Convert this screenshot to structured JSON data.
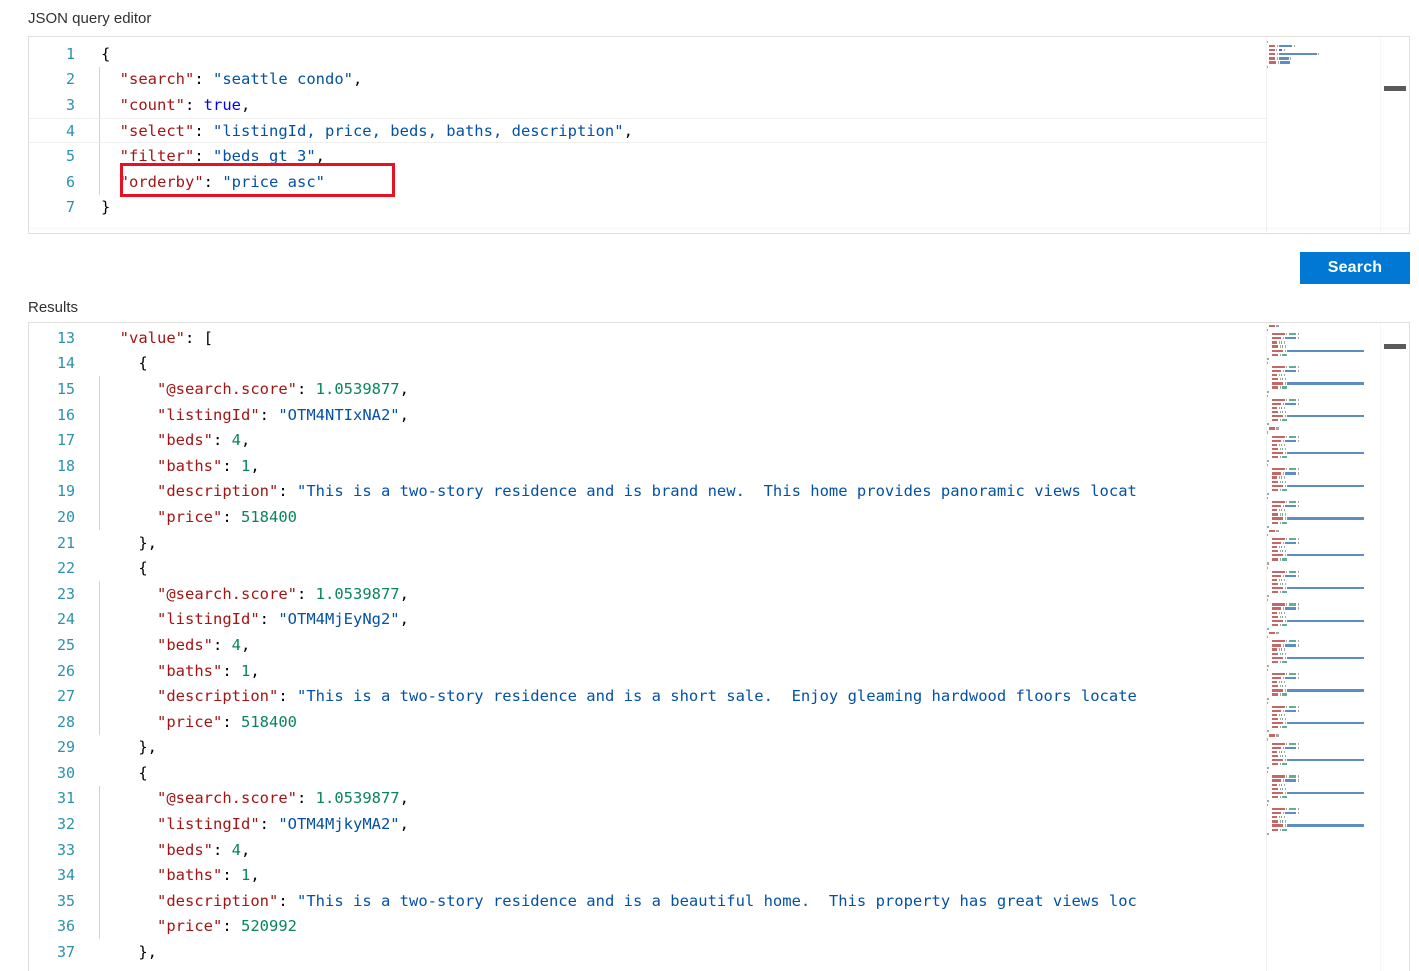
{
  "editor_section": {
    "label": "JSON query editor",
    "lines": [
      {
        "num": "1",
        "current": false,
        "indent_guide": false,
        "tokens": [
          {
            "t": "{",
            "c": "punc"
          }
        ]
      },
      {
        "num": "2",
        "current": false,
        "indent_guide": true,
        "tokens": [
          {
            "t": "  ",
            "c": "punc"
          },
          {
            "t": "\"search\"",
            "c": "key"
          },
          {
            "t": ": ",
            "c": "punc"
          },
          {
            "t": "\"seattle condo\"",
            "c": "str"
          },
          {
            "t": ",",
            "c": "punc"
          }
        ]
      },
      {
        "num": "3",
        "current": false,
        "indent_guide": true,
        "tokens": [
          {
            "t": "  ",
            "c": "punc"
          },
          {
            "t": "\"count\"",
            "c": "key"
          },
          {
            "t": ": ",
            "c": "punc"
          },
          {
            "t": "true",
            "c": "bool"
          },
          {
            "t": ",",
            "c": "punc"
          }
        ]
      },
      {
        "num": "4",
        "current": true,
        "indent_guide": true,
        "tokens": [
          {
            "t": "  ",
            "c": "punc"
          },
          {
            "t": "\"select\"",
            "c": "key"
          },
          {
            "t": ": ",
            "c": "punc"
          },
          {
            "t": "\"listingId, price, beds, baths, description\"",
            "c": "str"
          },
          {
            "t": ",",
            "c": "punc"
          }
        ]
      },
      {
        "num": "5",
        "current": false,
        "indent_guide": true,
        "tokens": [
          {
            "t": "  ",
            "c": "punc"
          },
          {
            "t": "\"filter\"",
            "c": "key"
          },
          {
            "t": ": ",
            "c": "punc"
          },
          {
            "t": "\"beds gt 3\"",
            "c": "str"
          },
          {
            "t": ",",
            "c": "punc"
          }
        ]
      },
      {
        "num": "6",
        "current": false,
        "indent_guide": true,
        "tokens": [
          {
            "t": "  ",
            "c": "punc"
          },
          {
            "t": "\"orderby\"",
            "c": "key"
          },
          {
            "t": ": ",
            "c": "punc"
          },
          {
            "t": "\"price asc\"",
            "c": "str"
          }
        ]
      },
      {
        "num": "7",
        "current": false,
        "indent_guide": false,
        "tokens": [
          {
            "t": "}",
            "c": "punc"
          }
        ]
      }
    ],
    "annotation": {
      "color": "#e81123",
      "target_line": "6",
      "target_text": "\"orderby\": \"price asc\""
    },
    "scroll_marker_color": "#5a5a5a"
  },
  "action_bar": {
    "search_label": "Search",
    "accent_color": "#0078d4"
  },
  "results_section": {
    "label": "Results",
    "lines": [
      {
        "num": "13",
        "current": false,
        "indent_guide": false,
        "tokens": [
          {
            "t": "  ",
            "c": "punc"
          },
          {
            "t": "\"value\"",
            "c": "key"
          },
          {
            "t": ": [",
            "c": "punc"
          }
        ]
      },
      {
        "num": "14",
        "current": false,
        "indent_guide": false,
        "tokens": [
          {
            "t": "    {",
            "c": "punc"
          }
        ]
      },
      {
        "num": "15",
        "current": false,
        "indent_guide": true,
        "tokens": [
          {
            "t": "      ",
            "c": "punc"
          },
          {
            "t": "\"@search.score\"",
            "c": "key"
          },
          {
            "t": ": ",
            "c": "punc"
          },
          {
            "t": "1.0539877",
            "c": "num"
          },
          {
            "t": ",",
            "c": "punc"
          }
        ]
      },
      {
        "num": "16",
        "current": false,
        "indent_guide": true,
        "tokens": [
          {
            "t": "      ",
            "c": "punc"
          },
          {
            "t": "\"listingId\"",
            "c": "key"
          },
          {
            "t": ": ",
            "c": "punc"
          },
          {
            "t": "\"OTM4NTIxNA2\"",
            "c": "str"
          },
          {
            "t": ",",
            "c": "punc"
          }
        ]
      },
      {
        "num": "17",
        "current": false,
        "indent_guide": true,
        "tokens": [
          {
            "t": "      ",
            "c": "punc"
          },
          {
            "t": "\"beds\"",
            "c": "key"
          },
          {
            "t": ": ",
            "c": "punc"
          },
          {
            "t": "4",
            "c": "num"
          },
          {
            "t": ",",
            "c": "punc"
          }
        ]
      },
      {
        "num": "18",
        "current": false,
        "indent_guide": true,
        "tokens": [
          {
            "t": "      ",
            "c": "punc"
          },
          {
            "t": "\"baths\"",
            "c": "key"
          },
          {
            "t": ": ",
            "c": "punc"
          },
          {
            "t": "1",
            "c": "num"
          },
          {
            "t": ",",
            "c": "punc"
          }
        ]
      },
      {
        "num": "19",
        "current": false,
        "indent_guide": true,
        "tokens": [
          {
            "t": "      ",
            "c": "punc"
          },
          {
            "t": "\"description\"",
            "c": "key"
          },
          {
            "t": ": ",
            "c": "punc"
          },
          {
            "t": "\"This is a two-story residence and is brand new.  This home provides panoramic views locat",
            "c": "str"
          }
        ]
      },
      {
        "num": "20",
        "current": false,
        "indent_guide": true,
        "tokens": [
          {
            "t": "      ",
            "c": "punc"
          },
          {
            "t": "\"price\"",
            "c": "key"
          },
          {
            "t": ": ",
            "c": "punc"
          },
          {
            "t": "518400",
            "c": "num"
          }
        ]
      },
      {
        "num": "21",
        "current": false,
        "indent_guide": false,
        "tokens": [
          {
            "t": "    },",
            "c": "punc"
          }
        ]
      },
      {
        "num": "22",
        "current": false,
        "indent_guide": false,
        "tokens": [
          {
            "t": "    {",
            "c": "punc"
          }
        ]
      },
      {
        "num": "23",
        "current": false,
        "indent_guide": true,
        "tokens": [
          {
            "t": "      ",
            "c": "punc"
          },
          {
            "t": "\"@search.score\"",
            "c": "key"
          },
          {
            "t": ": ",
            "c": "punc"
          },
          {
            "t": "1.0539877",
            "c": "num"
          },
          {
            "t": ",",
            "c": "punc"
          }
        ]
      },
      {
        "num": "24",
        "current": false,
        "indent_guide": true,
        "tokens": [
          {
            "t": "      ",
            "c": "punc"
          },
          {
            "t": "\"listingId\"",
            "c": "key"
          },
          {
            "t": ": ",
            "c": "punc"
          },
          {
            "t": "\"OTM4MjEyNg2\"",
            "c": "str"
          },
          {
            "t": ",",
            "c": "punc"
          }
        ]
      },
      {
        "num": "25",
        "current": false,
        "indent_guide": true,
        "tokens": [
          {
            "t": "      ",
            "c": "punc"
          },
          {
            "t": "\"beds\"",
            "c": "key"
          },
          {
            "t": ": ",
            "c": "punc"
          },
          {
            "t": "4",
            "c": "num"
          },
          {
            "t": ",",
            "c": "punc"
          }
        ]
      },
      {
        "num": "26",
        "current": false,
        "indent_guide": true,
        "tokens": [
          {
            "t": "      ",
            "c": "punc"
          },
          {
            "t": "\"baths\"",
            "c": "key"
          },
          {
            "t": ": ",
            "c": "punc"
          },
          {
            "t": "1",
            "c": "num"
          },
          {
            "t": ",",
            "c": "punc"
          }
        ]
      },
      {
        "num": "27",
        "current": false,
        "indent_guide": true,
        "tokens": [
          {
            "t": "      ",
            "c": "punc"
          },
          {
            "t": "\"description\"",
            "c": "key"
          },
          {
            "t": ": ",
            "c": "punc"
          },
          {
            "t": "\"This is a two-story residence and is a short sale.  Enjoy gleaming hardwood floors locate",
            "c": "str"
          }
        ]
      },
      {
        "num": "28",
        "current": false,
        "indent_guide": true,
        "tokens": [
          {
            "t": "      ",
            "c": "punc"
          },
          {
            "t": "\"price\"",
            "c": "key"
          },
          {
            "t": ": ",
            "c": "punc"
          },
          {
            "t": "518400",
            "c": "num"
          }
        ]
      },
      {
        "num": "29",
        "current": false,
        "indent_guide": false,
        "tokens": [
          {
            "t": "    },",
            "c": "punc"
          }
        ]
      },
      {
        "num": "30",
        "current": false,
        "indent_guide": false,
        "tokens": [
          {
            "t": "    {",
            "c": "punc"
          }
        ]
      },
      {
        "num": "31",
        "current": false,
        "indent_guide": true,
        "tokens": [
          {
            "t": "      ",
            "c": "punc"
          },
          {
            "t": "\"@search.score\"",
            "c": "key"
          },
          {
            "t": ": ",
            "c": "punc"
          },
          {
            "t": "1.0539877",
            "c": "num"
          },
          {
            "t": ",",
            "c": "punc"
          }
        ]
      },
      {
        "num": "32",
        "current": false,
        "indent_guide": true,
        "tokens": [
          {
            "t": "      ",
            "c": "punc"
          },
          {
            "t": "\"listingId\"",
            "c": "key"
          },
          {
            "t": ": ",
            "c": "punc"
          },
          {
            "t": "\"OTM4MjkyMA2\"",
            "c": "str"
          },
          {
            "t": ",",
            "c": "punc"
          }
        ]
      },
      {
        "num": "33",
        "current": false,
        "indent_guide": true,
        "tokens": [
          {
            "t": "      ",
            "c": "punc"
          },
          {
            "t": "\"beds\"",
            "c": "key"
          },
          {
            "t": ": ",
            "c": "punc"
          },
          {
            "t": "4",
            "c": "num"
          },
          {
            "t": ",",
            "c": "punc"
          }
        ]
      },
      {
        "num": "34",
        "current": false,
        "indent_guide": true,
        "tokens": [
          {
            "t": "      ",
            "c": "punc"
          },
          {
            "t": "\"baths\"",
            "c": "key"
          },
          {
            "t": ": ",
            "c": "punc"
          },
          {
            "t": "1",
            "c": "num"
          },
          {
            "t": ",",
            "c": "punc"
          }
        ]
      },
      {
        "num": "35",
        "current": false,
        "indent_guide": true,
        "tokens": [
          {
            "t": "      ",
            "c": "punc"
          },
          {
            "t": "\"description\"",
            "c": "key"
          },
          {
            "t": ": ",
            "c": "punc"
          },
          {
            "t": "\"This is a two-story residence and is a beautiful home.  This property has great views loc",
            "c": "str"
          }
        ]
      },
      {
        "num": "36",
        "current": false,
        "indent_guide": true,
        "tokens": [
          {
            "t": "      ",
            "c": "punc"
          },
          {
            "t": "\"price\"",
            "c": "key"
          },
          {
            "t": ": ",
            "c": "punc"
          },
          {
            "t": "520992",
            "c": "num"
          }
        ]
      },
      {
        "num": "37",
        "current": false,
        "indent_guide": false,
        "tokens": [
          {
            "t": "    },",
            "c": "punc"
          }
        ]
      }
    ],
    "scroll_marker_color": "#5a5a5a"
  },
  "syntax_colors": {
    "key": "#a31515",
    "string": "#0451a5",
    "number": "#098658",
    "boolean": "#0000ff",
    "punctuation": "#000000",
    "line_number": "#2b91af"
  }
}
